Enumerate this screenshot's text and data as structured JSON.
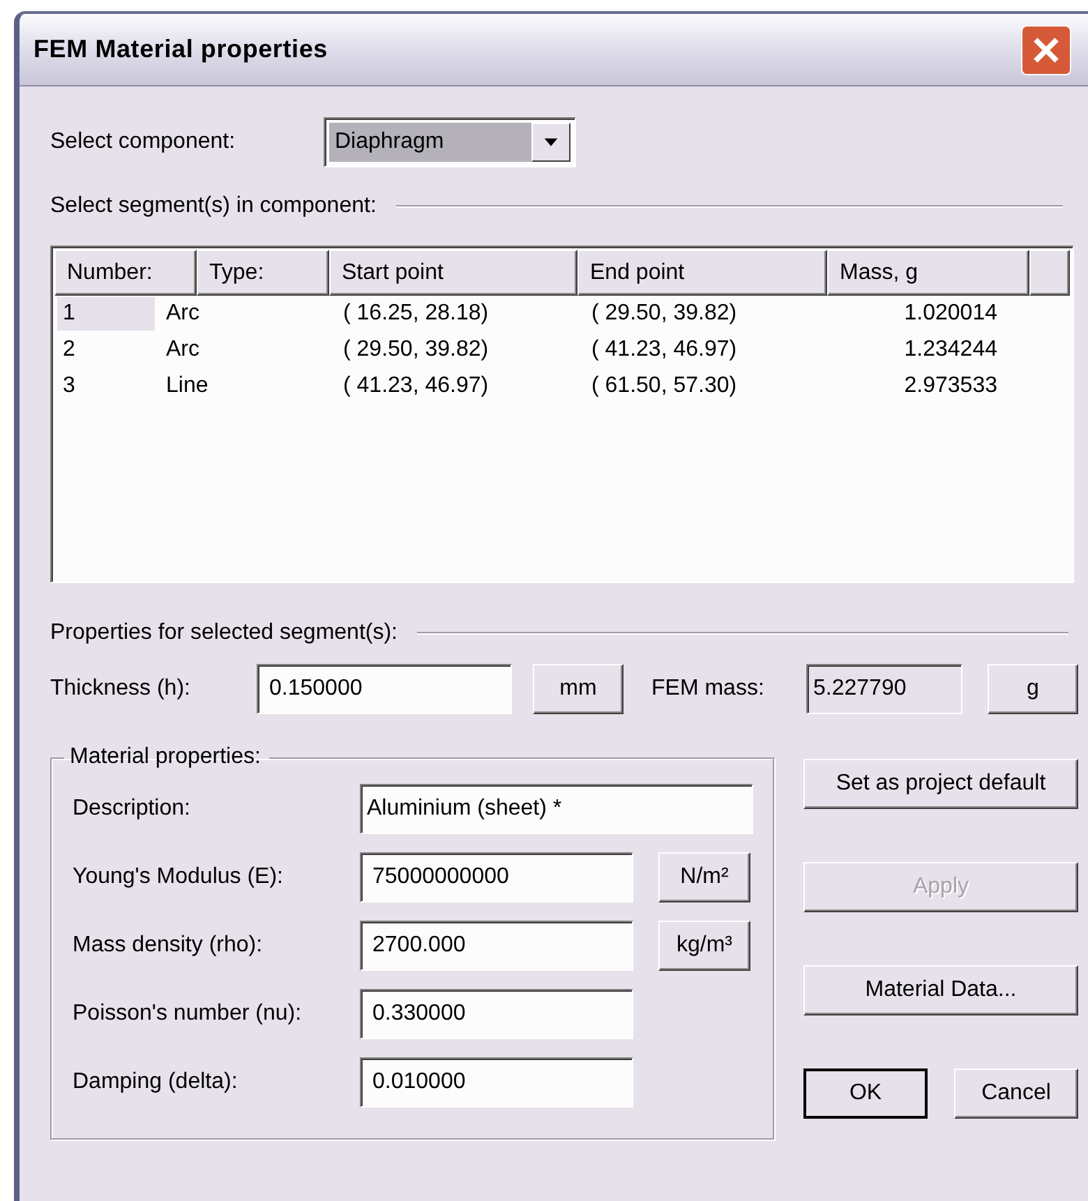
{
  "window": {
    "title": "FEM Material properties"
  },
  "component": {
    "label": "Select component:",
    "value": "Diaphragm"
  },
  "segments": {
    "label": "Select segment(s) in component:",
    "columns": [
      "Number:",
      "Type:",
      "Start point",
      "End point",
      "Mass, g"
    ],
    "rows": [
      {
        "selected": true,
        "cells": [
          "1",
          "Arc",
          "( 16.25, 28.18)",
          "( 29.50, 39.82)",
          "1.020014"
        ]
      },
      {
        "selected": false,
        "cells": [
          "2",
          "Arc",
          "( 29.50, 39.82)",
          "( 41.23, 46.97)",
          "1.234244"
        ]
      },
      {
        "selected": false,
        "cells": [
          "3",
          "Line",
          "( 41.23, 46.97)",
          "( 61.50, 57.30)",
          "2.973533"
        ]
      }
    ]
  },
  "properties": {
    "label": "Properties for selected segment(s):",
    "thickness": {
      "label": "Thickness (h):",
      "value": "0.150000",
      "unit": "mm"
    },
    "fem_mass": {
      "label": "FEM mass:",
      "value": "5.227790",
      "unit": "g"
    }
  },
  "material": {
    "label": "Material properties:",
    "fields": [
      {
        "kind": "wide",
        "label": "Description:",
        "value": "Aluminium (sheet) *"
      },
      {
        "kind": "unit",
        "label": "Young's Modulus (E):",
        "value": "75000000000",
        "unit": "N/m²"
      },
      {
        "kind": "unit",
        "label": "Mass density (rho):",
        "value": "2700.000",
        "unit": "kg/m³"
      },
      {
        "kind": "plain",
        "label": "Poisson's number (nu):",
        "value": "0.330000"
      },
      {
        "kind": "plain",
        "label": "Damping (delta):",
        "value": "0.010000"
      }
    ]
  },
  "side_buttons": [
    {
      "label": "Set as project default",
      "disabled": false,
      "default": false
    },
    {
      "label": "Apply",
      "disabled": true,
      "default": false
    },
    {
      "label": "Material Data...",
      "disabled": false,
      "default": false
    }
  ],
  "footer_buttons": [
    {
      "label": "OK",
      "disabled": false,
      "default": true
    },
    {
      "label": "Cancel",
      "disabled": false,
      "default": false
    }
  ]
}
